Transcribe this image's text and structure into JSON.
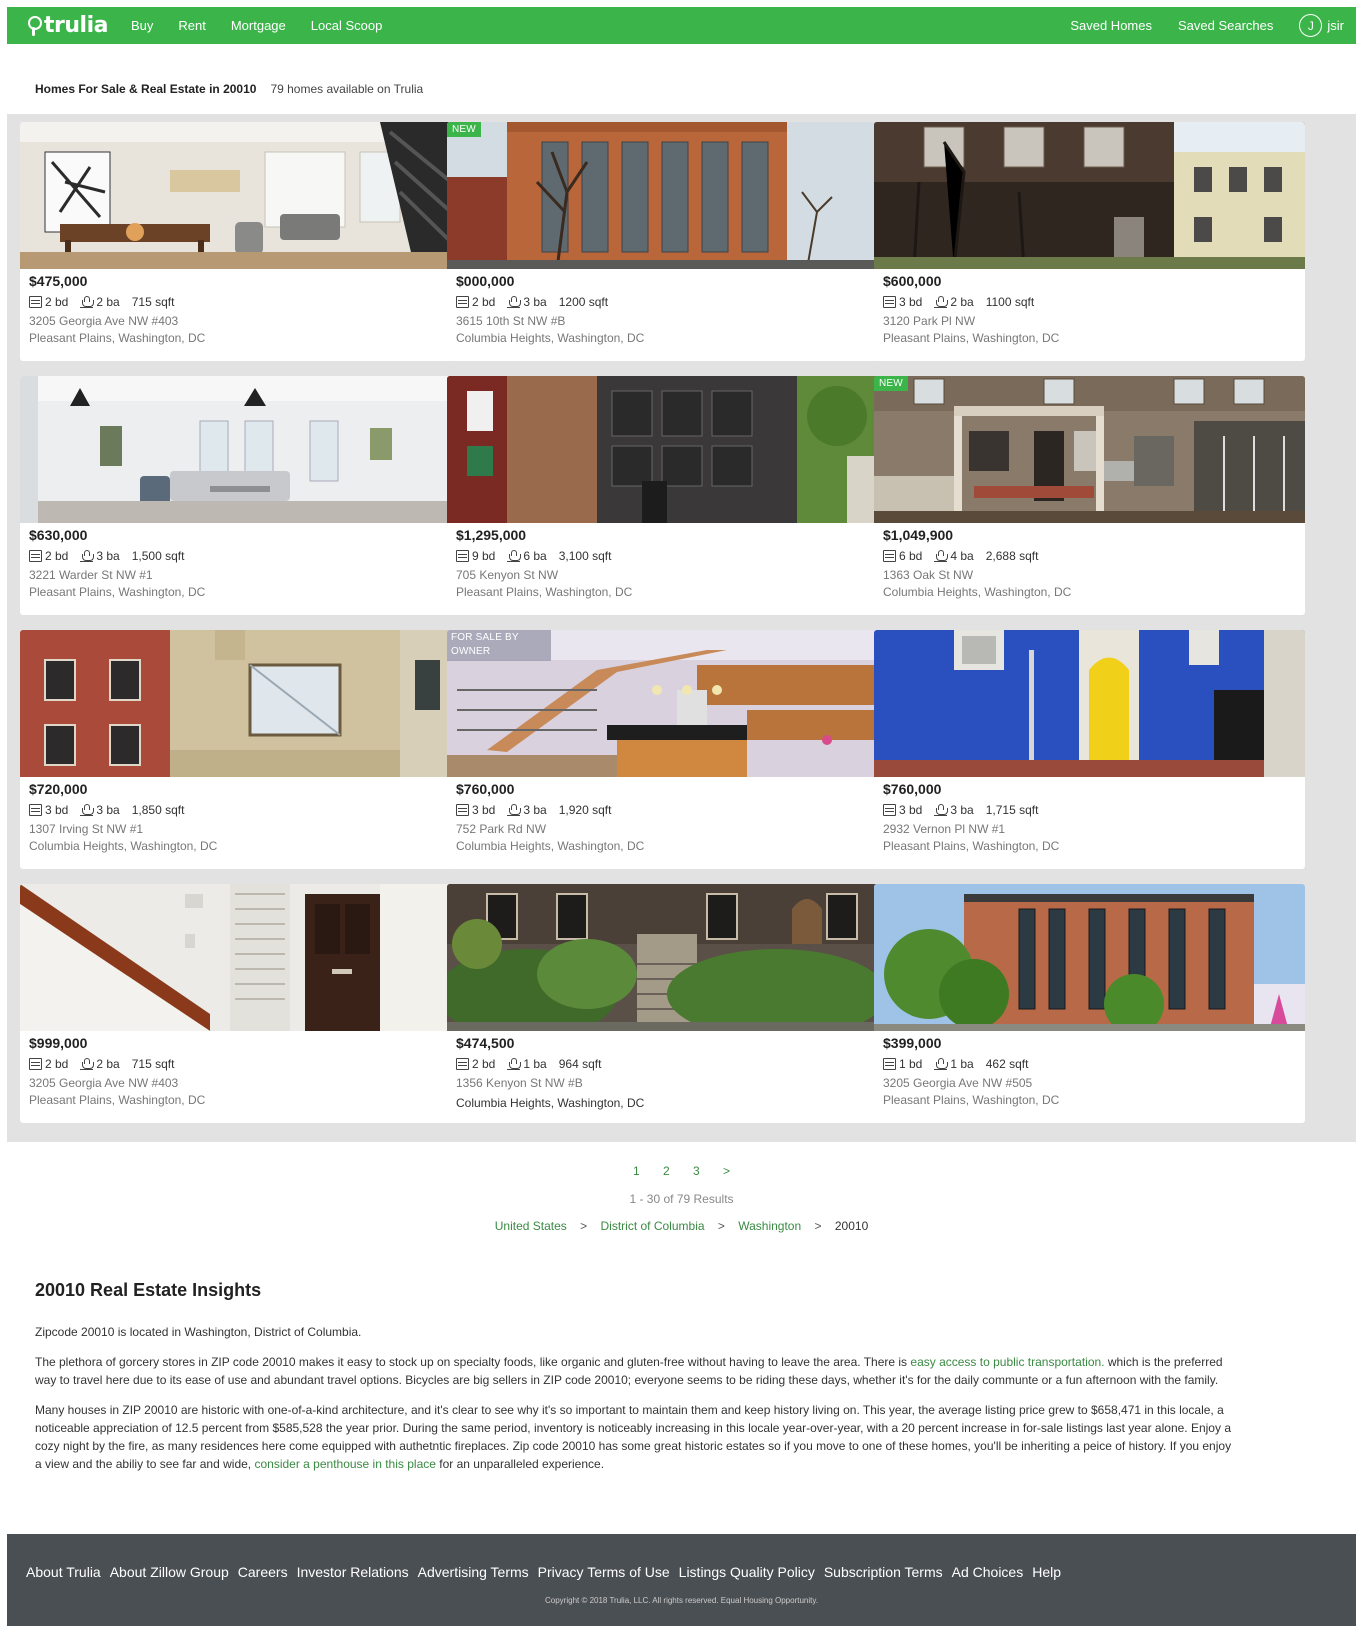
{
  "header": {
    "logo": "trulia",
    "nav": [
      "Buy",
      "Rent",
      "Mortgage",
      "Local Scoop"
    ],
    "saved_homes": "Saved Homes",
    "saved_searches": "Saved Searches",
    "user_initial": "J",
    "user_name": "jsir"
  },
  "page": {
    "title": "Homes For Sale & Real Estate in 20010",
    "count": "79 homes available on Trulia"
  },
  "listings": [
    {
      "price": "$475,000",
      "beds": "2 bd",
      "baths": "2 ba",
      "sqft": "715 sqft",
      "address": "3205 Georgia Ave NW #403",
      "locale": "Pleasant Plains, Washington, DC",
      "badge": "",
      "photo": "interior-dining"
    },
    {
      "price": "$000,000",
      "beds": "2 bd",
      "baths": "3 ba",
      "sqft": "1200 sqft",
      "address": "3615 10th St NW #B",
      "locale": "Columbia Heights, Washington, DC",
      "badge": "NEW",
      "photo": "brick-building"
    },
    {
      "price": "$600,000",
      "beds": "3 bd",
      "baths": "2 ba",
      "sqft": "1100 sqft",
      "address": "3120 Park Pl NW",
      "locale": "Pleasant Plains, Washington, DC",
      "badge": "",
      "photo": "rowhouse-dark"
    },
    {
      "price": "$630,000",
      "beds": "2 bd",
      "baths": "3 ba",
      "sqft": "1,500 sqft",
      "address": "3221 Warder St NW #1",
      "locale": "Pleasant Plains, Washington, DC",
      "badge": "",
      "photo": "white-living"
    },
    {
      "price": "$1,295,000",
      "beds": "9 bd",
      "baths": "6 ba",
      "sqft": "3,100 sqft",
      "address": "705 Kenyon St NW",
      "locale": "Pleasant Plains, Washington, DC",
      "badge": "",
      "photo": "modern-facade"
    },
    {
      "price": "$1,049,900",
      "beds": "6 bd",
      "baths": "4 ba",
      "sqft": "2,688 sqft",
      "address": "1363 Oak St NW",
      "locale": "Columbia Heights, Washington, DC",
      "badge": "NEW",
      "photo": "porch-house"
    },
    {
      "price": "$720,000",
      "beds": "3 bd",
      "baths": "3 ba",
      "sqft": "1,850 sqft",
      "address": "1307 Irving St NW #1",
      "locale": "Columbia Heights, Washington, DC",
      "badge": "",
      "photo": "tan-building"
    },
    {
      "price": "$760,000",
      "beds": "3 bd",
      "baths": "3 ba",
      "sqft": "1,920 sqft",
      "address": "752 Park Rd NW",
      "locale": "Columbia Heights, Washington, DC",
      "badge": "FOR SALE BY OWNER",
      "photo": "kitchen-stairs"
    },
    {
      "price": "$760,000",
      "beds": "3 bd",
      "baths": "3 ba",
      "sqft": "1,715 sqft",
      "address": "2932 Vernon Pl NW #1",
      "locale": "Pleasant Plains, Washington, DC",
      "badge": "",
      "photo": "blue-wall"
    },
    {
      "price": "$999,000",
      "beds": "2 bd",
      "baths": "2 ba",
      "sqft": "715 sqft",
      "address": "3205 Georgia Ave NW #403",
      "locale": "Pleasant Plains, Washington, DC",
      "badge": "",
      "photo": "hall-door"
    },
    {
      "price": "$474,500",
      "beds": "2 bd",
      "baths": "1 ba",
      "sqft": "964 sqft",
      "address": "1356 Kenyon St NW #B",
      "locale": "Columbia Heights, Washington, DC",
      "badge": "",
      "photo": "garden-rowhouse"
    },
    {
      "price": "$399,000",
      "beds": "1 bd",
      "baths": "1 ba",
      "sqft": "462 sqft",
      "address": "3205 Georgia Ave NW #505",
      "locale": "Pleasant Plains, Washington, DC",
      "badge": "",
      "photo": "brick-condo"
    }
  ],
  "pagination": {
    "pages": [
      "1",
      "2",
      "3",
      ">"
    ],
    "results": "1 - 30 of 79 Results"
  },
  "breadcrumb": [
    "United States",
    "District of Columbia",
    "Washington",
    "20010"
  ],
  "breadcrumb_sep": ">",
  "insights": {
    "title": "20010 Real Estate Insights",
    "p1": "Zipcode 20010 is located in Washington, District of Columbia.",
    "p2_a": "The plethora of gorcery stores in ZIP code 20010 makes it easy to stock up on specialty foods, like organic and gluten-free without having to leave the area. There is ",
    "p2_link": "easy access to public transportation.",
    "p2_b": " which is the preferred way to travel here due to its ease of use and abundant travel options. Bicycles are big sellers in ZIP code 20010; everyone seems to be riding these days, whether it's for the daily communte or a fun afternoon with the family.",
    "p3_a": "Many houses in ZIP 20010 are historic with one-of-a-kind architecture, and it's clear to see why it's so important to maintain them and keep history living on. This year, the average listing price grew to $658,471 in this locale, a noticeable appreciation of 12.5 percent from $585,528 the year prior. During the same period, inventory is noticeably increasing in this locale year-over-year, with a 20 percent increase in for-sale listings last year alone. Enjoy a cozy night by the fire, as many residences here come equipped with authetntic fireplaces. Zip code 20010 has some great historic estates so if you move to one of these homes, you'll be inheriting a peice of history. If you enjoy a view and the abiliy to see far and wide, ",
    "p3_link": "consider a penthouse in this place",
    "p3_b": " for an unparalleled experience."
  },
  "footer": {
    "links": [
      "About Trulia",
      "About Zillow Group",
      "Careers",
      "Investor Relations",
      "Advertising Terms",
      "Privacy Terms of Use",
      "Listings Quality Policy",
      "Subscription Terms",
      "Ad Choices",
      "Help"
    ],
    "copyright": "Copyright © 2018 Trulia, LLC. All rights reserved. Equal Housing Opportunity."
  },
  "colors": {
    "brand_green": "#3bb54a",
    "link_green": "#3a8a43",
    "footer_bg": "#4a4f53",
    "grid_bg": "#e2e2e2"
  }
}
